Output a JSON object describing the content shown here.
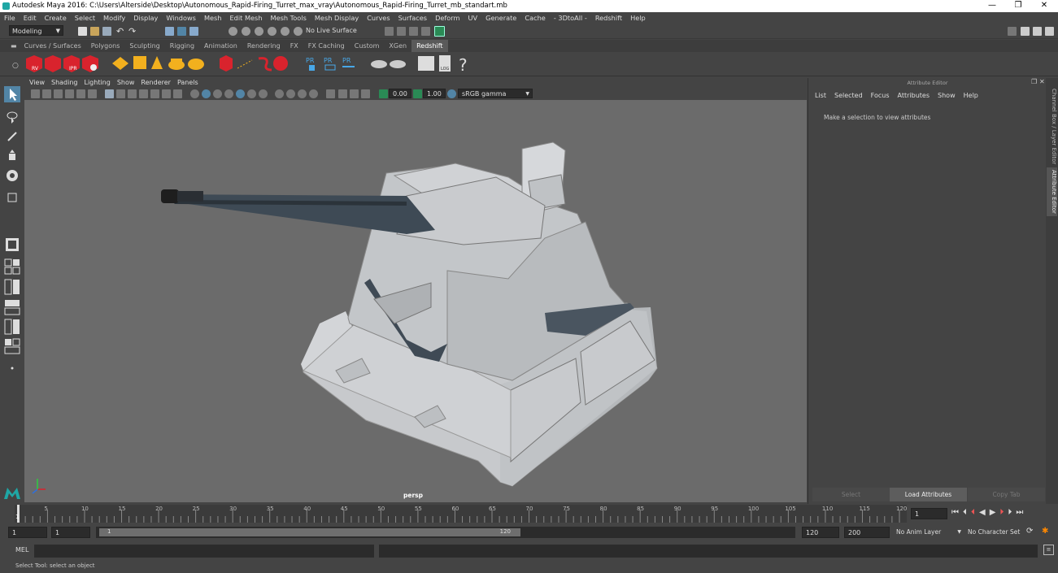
{
  "window": {
    "title": "Autodesk Maya 2016: C:\\Users\\Alterside\\Desktop\\Autonomous_Rapid-Firing_Turret_max_vray\\Autonomous_Rapid-Firing_Turret_mb_standart.mb",
    "minimize": "—",
    "restore": "❐",
    "close": "✕"
  },
  "menubar": [
    "File",
    "Edit",
    "Create",
    "Select",
    "Modify",
    "Display",
    "Windows",
    "Mesh",
    "Edit Mesh",
    "Mesh Tools",
    "Mesh Display",
    "Curves",
    "Surfaces",
    "Deform",
    "UV",
    "Generate",
    "Cache",
    "- 3DtoAll -",
    "Redshift",
    "Help"
  ],
  "status_line": {
    "mode": "Modeling",
    "live_surface": "No Live Surface"
  },
  "shelf_tabs": [
    "Curves / Surfaces",
    "Polygons",
    "Sculpting",
    "Rigging",
    "Animation",
    "Rendering",
    "FX",
    "FX Caching",
    "Custom",
    "XGen",
    "Redshift"
  ],
  "shelf_active": "Redshift",
  "shelf_icon_labels": {
    "rv": "RV",
    "ipr": "IPR",
    "pr1": "PR",
    "pr2": "PR",
    "pr3": "PR",
    "log": "LOG"
  },
  "viewport": {
    "menu": [
      "View",
      "Shading",
      "Lighting",
      "Show",
      "Renderer",
      "Panels"
    ],
    "exposure": "0.00",
    "gamma": "1.00",
    "color_space": "sRGB gamma",
    "camera_label": "persp"
  },
  "attribute_editor": {
    "title": "Attribute Editor",
    "menu": [
      "List",
      "Selected",
      "Focus",
      "Attributes",
      "Show",
      "Help"
    ],
    "message": "Make a selection to view attributes",
    "buttons": {
      "select": "Select",
      "load": "Load Attributes",
      "copy": "Copy Tab"
    }
  },
  "side_tabs": [
    "Channel Box / Layer Editor",
    "Attribute Editor"
  ],
  "timeline": {
    "ticks": [
      "5",
      "10",
      "15",
      "20",
      "25",
      "30",
      "35",
      "40",
      "45",
      "50",
      "55",
      "60",
      "65",
      "70",
      "75",
      "80",
      "85",
      "90",
      "95",
      "100",
      "105",
      "110",
      "115",
      "120"
    ],
    "current_marker": "1",
    "current_frame": "1"
  },
  "range": {
    "start": "1",
    "playback_start": "1",
    "slider_start": "1",
    "slider_end": "120",
    "playback_end": "120",
    "end": "200",
    "anim_layer": "No Anim Layer",
    "character_set": "No Character Set"
  },
  "command_line": {
    "label": "MEL"
  },
  "help_line": "Select Tool: select an object",
  "colors": {
    "viewport_bg": "#6b6b6b",
    "ui_bg": "#444444",
    "accent": "#5285a6",
    "redshift_red": "#d9232d"
  }
}
